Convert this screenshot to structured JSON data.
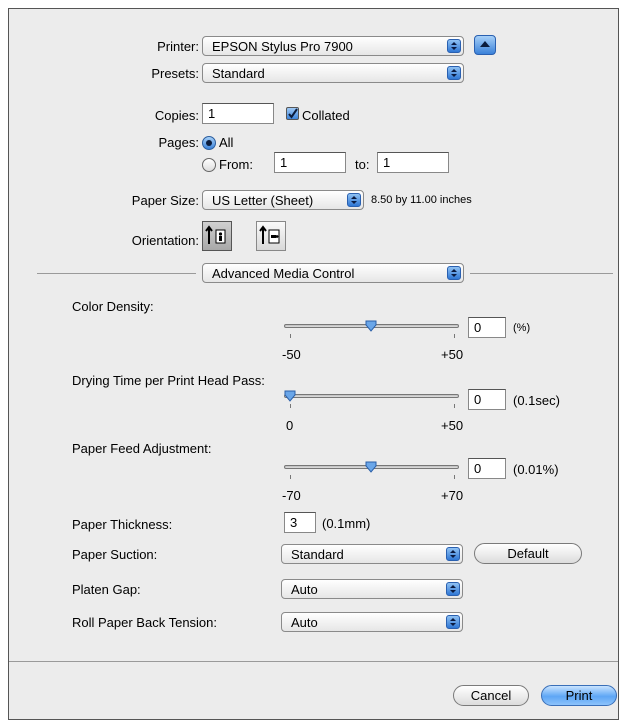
{
  "printer": {
    "label": "Printer:",
    "value": "EPSON Stylus Pro 7900"
  },
  "presets": {
    "label": "Presets:",
    "value": "Standard"
  },
  "copies": {
    "label": "Copies:",
    "value": "1",
    "collated_label": "Collated",
    "collated_checked": true
  },
  "pages": {
    "label": "Pages:",
    "all_label": "All",
    "from_label": "From:",
    "from_value": "1",
    "to_label": "to:",
    "to_value": "1"
  },
  "paper_size": {
    "label": "Paper Size:",
    "value": "US Letter (Sheet)",
    "dims": "8.50 by 11.00 inches"
  },
  "orientation": {
    "label": "Orientation:"
  },
  "panel": {
    "value": "Advanced Media Control"
  },
  "color_density": {
    "label": "Color Density:",
    "value": "0",
    "unit": "(%)",
    "min": "-50",
    "max": "+50",
    "level": 0
  },
  "drying_time": {
    "label": "Drying Time per Print Head Pass:",
    "value": "0",
    "unit": "(0.1sec)",
    "min": "0",
    "max": "+50",
    "level": 0
  },
  "paper_feed": {
    "label": "Paper Feed Adjustment:",
    "value": "0",
    "unit": "(0.01%)",
    "min": "-70",
    "max": "+70",
    "level": 0
  },
  "paper_thickness": {
    "label": "Paper Thickness:",
    "value": "3",
    "unit": "(0.1mm)"
  },
  "paper_suction": {
    "label": "Paper Suction:",
    "value": "Standard",
    "default_label": "Default"
  },
  "platen_gap": {
    "label": "Platen Gap:",
    "value": "Auto"
  },
  "roll_tension": {
    "label": "Roll Paper Back Tension:",
    "value": "Auto"
  },
  "footer": {
    "cancel": "Cancel",
    "print": "Print"
  },
  "colors": {
    "accent": "#3d85dc",
    "background": "#ececec"
  },
  "icons": {
    "expand": "disclosure-triangle-icon",
    "portrait": "portrait-orientation-icon",
    "landscape": "landscape-orientation-icon"
  }
}
